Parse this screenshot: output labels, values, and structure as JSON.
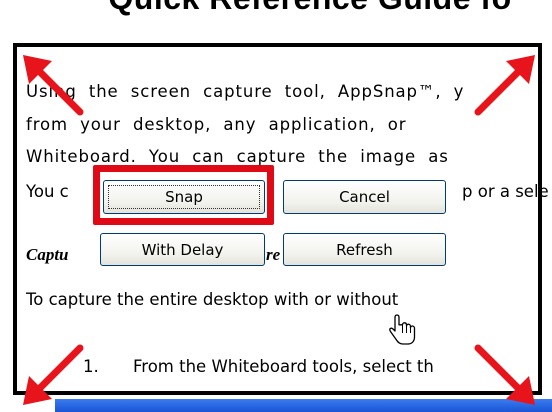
{
  "document": {
    "title": "Quick Reference Guide fo",
    "paragraph_lines": [
      "Using the screen capture tool, AppSnap™, y",
      "from your desktop, any application, or",
      "Whiteboard. You can capture the image as",
      "You c",
      "p or a sele"
    ],
    "section_heading_fragment_1": "Captu",
    "section_heading_fragment_2": "re",
    "instruction_line": "To capture the entire desktop with or without",
    "list_item": {
      "number": "1.",
      "text": "From the Whiteboard tools, select th"
    }
  },
  "dialog": {
    "buttons": {
      "snap": "Snap",
      "cancel": "Cancel",
      "with_delay": "With Delay",
      "refresh": "Refresh"
    }
  },
  "annotations": {
    "arrow_color": "#e8141c",
    "highlight_color": "#e00a16",
    "highlight_target": "snap"
  },
  "colors": {
    "button_border": "#003c74",
    "bottom_bar": "#1a55d6"
  },
  "icons": {
    "arrows": [
      "arrow-top-left-icon",
      "arrow-top-right-icon",
      "arrow-bottom-left-icon",
      "arrow-bottom-right-icon"
    ],
    "cursor": "hand-pointer-cursor-icon"
  }
}
